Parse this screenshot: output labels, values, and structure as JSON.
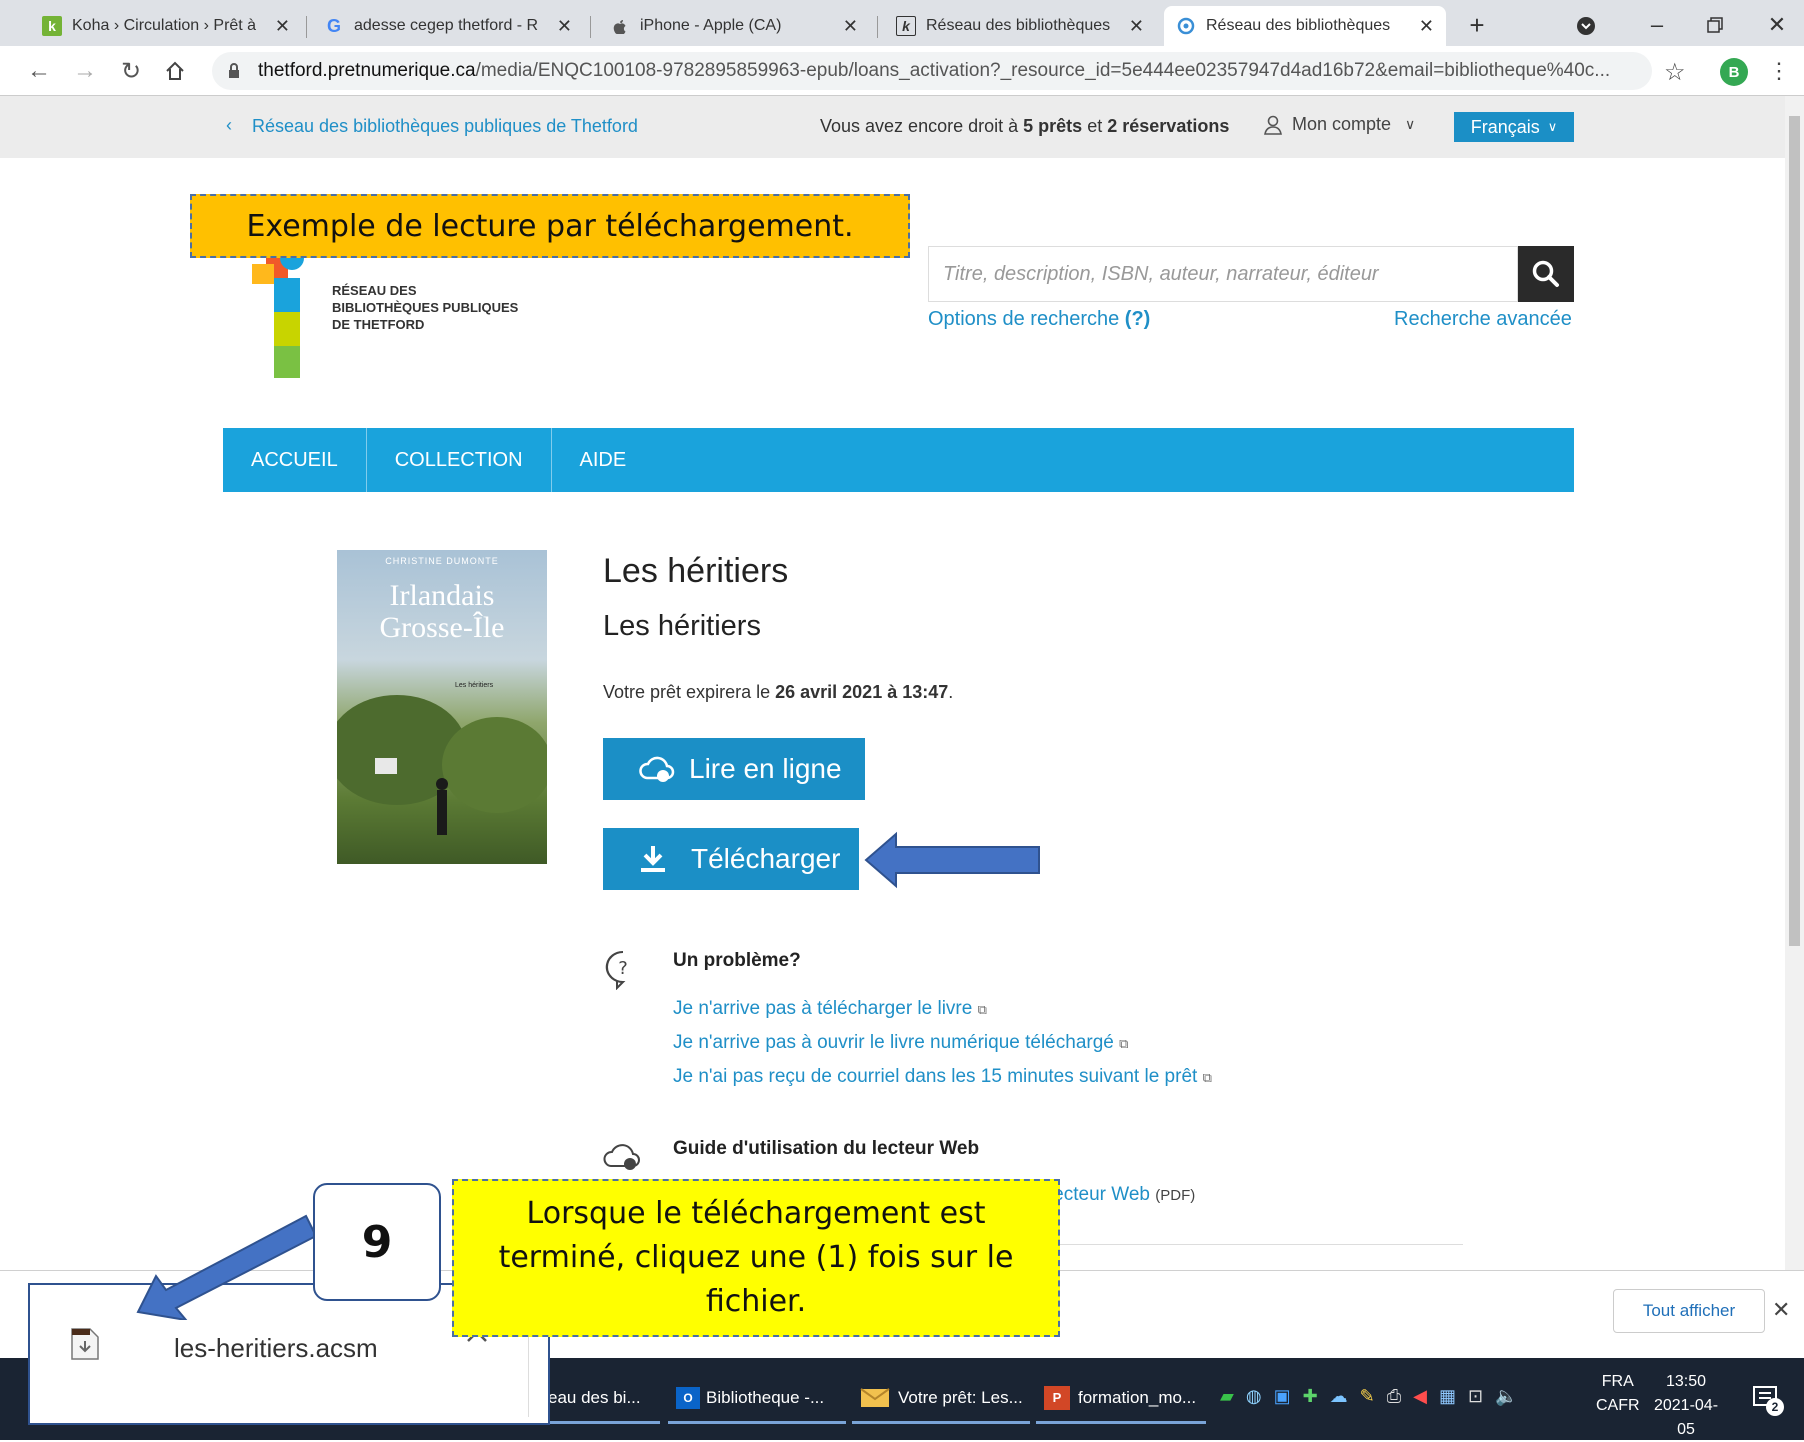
{
  "browser": {
    "tabs": [
      {
        "title": "Koha › Circulation › Prêt à",
        "icon": "koha-icon"
      },
      {
        "title": "adesse cegep thetford - R",
        "icon": "google-icon"
      },
      {
        "title": "iPhone - Apple (CA)",
        "icon": "apple-icon"
      },
      {
        "title": "Réseau des bibliothèques",
        "icon": "koha-icon"
      },
      {
        "title": "Réseau des bibliothèques",
        "icon": "pretnumerique-icon"
      }
    ],
    "url_host": "thetford.pretnumerique.ca",
    "url_path": "/media/ENQC100108-9782895859963-epub/loans_activation?_resource_id=5e444ee02357947d4ad16b72&email=bibliotheque%40c...",
    "profile_initial": "B"
  },
  "site": {
    "back_link": "Réseau des bibliothèques publiques de Thetford",
    "quota_prefix": "Vous avez encore droit à",
    "quota_loans_num": "5",
    "quota_loans_word": "prêts",
    "quota_and": "et",
    "quota_res_num": "2",
    "quota_res_word": "réservations",
    "account_label": "Mon compte",
    "language_label": "Français",
    "logo_line1": "RÉSEAU DES",
    "logo_line2": "BIBLIOTHÈQUES PUBLIQUES",
    "logo_line3": "DE THETFORD",
    "search_placeholder": "Titre, description, ISBN, auteur, narrateur, éditeur",
    "search_options": "Options de recherche",
    "search_options_help": "(?)",
    "advanced_search": "Recherche avancée",
    "nav": [
      "ACCUEIL",
      "COLLECTION",
      "AIDE"
    ]
  },
  "book": {
    "title": "Les héritiers",
    "subtitle": "Les héritiers",
    "cover_author": "CHRISTINE DUMONTE",
    "cover_title_line1": "Irlandais",
    "cover_title_line2": "Grosse-Île",
    "cover_volume": "Les héritiers",
    "loan_prefix": "Votre prêt expirera le",
    "loan_date": "26 avril 2021 à 13:47",
    "loan_suffix": ".",
    "read_online": "Lire en ligne",
    "download": "Télécharger"
  },
  "help": {
    "problem_title": "Un problème?",
    "links": [
      "Je n'arrive pas à télécharger le livre",
      "Je n'arrive pas à ouvrir le livre numérique téléchargé",
      "Je n'ai pas reçu de courriel dans les 15 minutes suivant le prêt"
    ],
    "guide_title": "Guide d'utilisation du lecteur Web",
    "guide_link": "Emprunter et ouvrir un livre numérique dans lecteur Web",
    "guide_format": "(PDF)"
  },
  "annotations": {
    "top_callout": "Exemple de lecture par téléchargement.",
    "step_number": "9",
    "bottom_callout": "Lorsque le téléchargement est terminé, cliquez une (1) fois sur le fichier."
  },
  "downloads": {
    "file_name": "les-heritiers.acsm",
    "show_all": "Tout afficher"
  },
  "taskbar": {
    "items": [
      "eau des bi...",
      "Bibliotheque -...",
      "Votre prêt: Les...",
      "formation_mo..."
    ],
    "lang_top": "FRA",
    "lang_bottom": "CAFR",
    "time": "13:50",
    "date": "2021-04-05",
    "notification_count": "2"
  },
  "colors": {
    "accent_blue": "#1b8fc6",
    "nav_blue": "#1aa3dc",
    "callout_orange": "#ffc000",
    "callout_yellow": "#ffff00"
  }
}
